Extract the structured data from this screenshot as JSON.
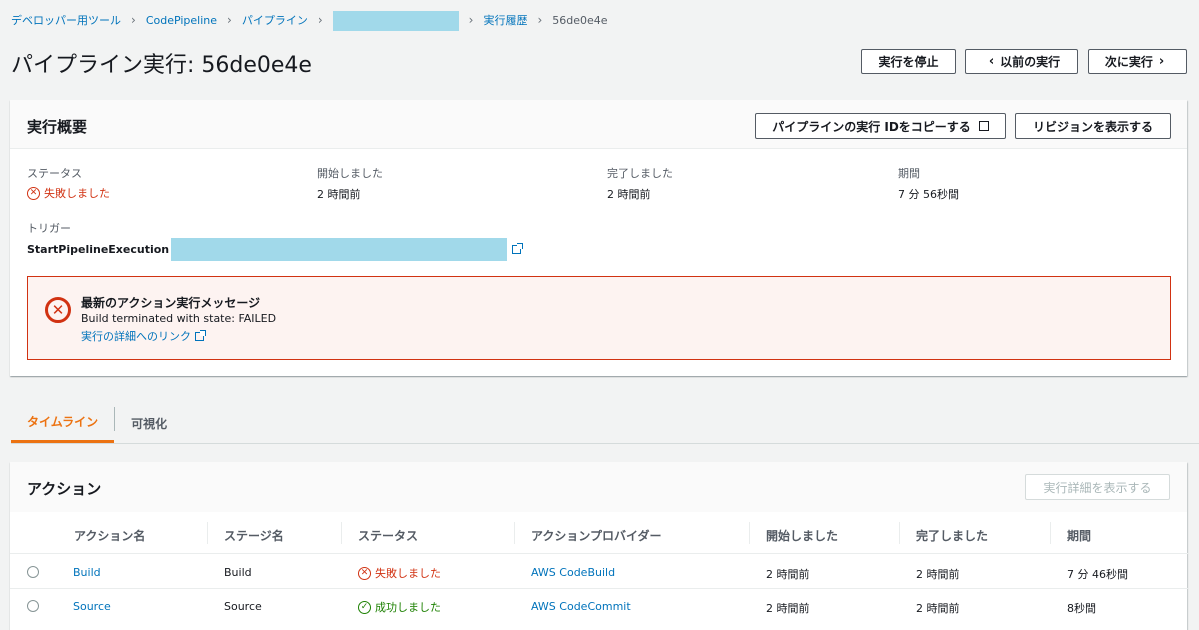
{
  "breadcrumb": {
    "items": [
      "デベロッパー用ツール",
      "CodePipeline",
      "パイプライン"
    ],
    "history": "実行履歴",
    "current": "56de0e4e"
  },
  "page": {
    "title": "パイプライン実行: 56de0e4e",
    "stop_button": "実行を停止",
    "prev_button": "以前の実行",
    "next_button": "次に実行"
  },
  "summary": {
    "title": "実行概要",
    "copy_button": "パイプラインの実行 IDをコピーする",
    "revisions_button": "リビジョンを表示する",
    "status_label": "ステータス",
    "status_value": "失敗しました",
    "started_label": "開始しました",
    "started_value": "2 時間前",
    "completed_label": "完了しました",
    "completed_value": "2 時間前",
    "duration_label": "期間",
    "duration_value": "7 分 56秒間",
    "trigger_label": "トリガー",
    "trigger_value": "StartPipelineExecution",
    "alert": {
      "title": "最新のアクション実行メッセージ",
      "message": "Build terminated with state: FAILED",
      "link": "実行の詳細へのリンク"
    }
  },
  "tabs": [
    {
      "label": "タイムライン",
      "active": true
    },
    {
      "label": "可視化",
      "active": false
    }
  ],
  "actions": {
    "title": "アクション",
    "details_button": "実行詳細を表示する",
    "columns": [
      "アクション名",
      "ステージ名",
      "ステータス",
      "アクションプロバイダー",
      "開始しました",
      "完了しました",
      "期間"
    ],
    "rows": [
      {
        "name": "Build",
        "stage": "Build",
        "status": "失敗しました",
        "provider": "AWS CodeBuild",
        "started": "2 時間前",
        "completed": "2 時間前",
        "duration": "7 分 46秒間"
      },
      {
        "name": "Source",
        "stage": "Source",
        "status": "成功しました",
        "provider": "AWS CodeCommit",
        "started": "2 時間前",
        "completed": "2 時間前",
        "duration": "8秒間"
      }
    ]
  },
  "colors": {
    "link": "#0073bb",
    "error": "#d13212",
    "success": "#1d8102",
    "accent": "#ec7211",
    "redaction": "#a1d9ea"
  }
}
